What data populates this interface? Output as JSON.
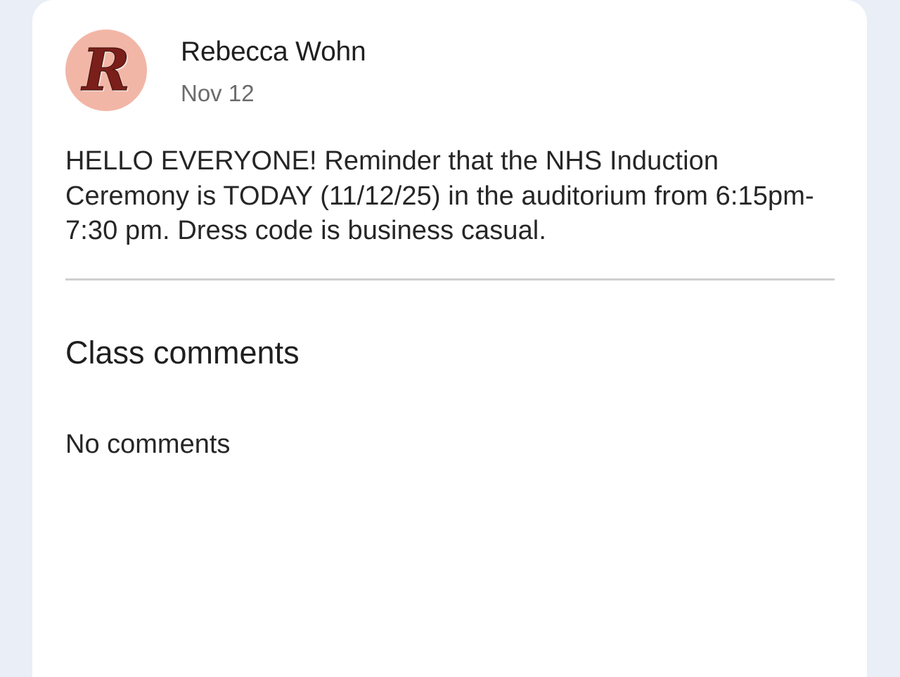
{
  "post": {
    "author": {
      "name": "Rebecca Wohn",
      "avatar_initial": "R",
      "avatar_color": "#f2b6a7",
      "avatar_letter_color": "#7a1f1a"
    },
    "date": "Nov 12",
    "body": "HELLO EVERYONE! Reminder that the NHS Induction Ceremony is TODAY (11/12/25) in the auditorium from 6:15pm-7:30 pm. Dress code is business casual."
  },
  "comments": {
    "heading": "Class comments",
    "empty_text": "No comments"
  },
  "colors": {
    "page_background": "#e9eef7",
    "card_background": "#ffffff",
    "divider": "#cfcfcf",
    "secondary_text": "#6b6b6b"
  }
}
